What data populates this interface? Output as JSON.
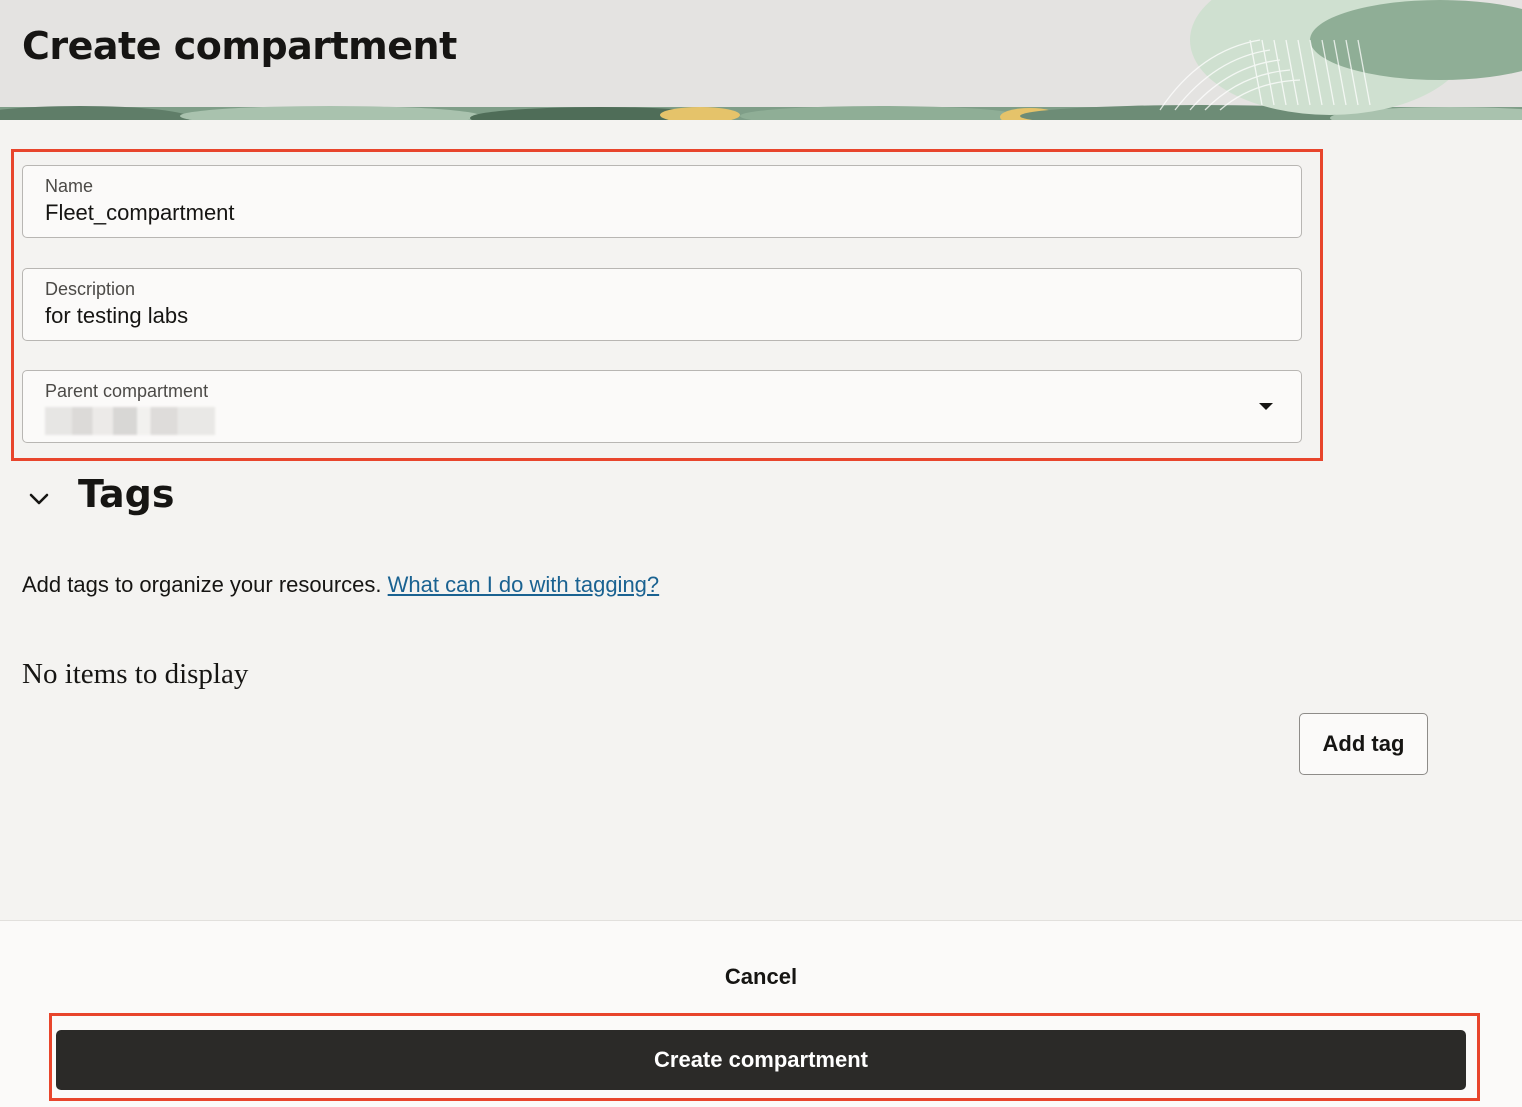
{
  "header": {
    "title": "Create compartment"
  },
  "form": {
    "name": {
      "label": "Name",
      "value": "Fleet_compartment"
    },
    "description": {
      "label": "Description",
      "value": "for testing labs"
    },
    "parent_compartment": {
      "label": "Parent compartment",
      "value_redacted": true
    }
  },
  "tags": {
    "heading": "Tags",
    "description": "Add tags to organize your resources.",
    "help_link": "What can I do with tagging?",
    "empty_message": "No items to display",
    "add_button": "Add tag"
  },
  "footer": {
    "cancel_label": "Cancel",
    "submit_label": "Create compartment"
  },
  "colors": {
    "highlight": "#e8452c",
    "link": "#1a6291",
    "primary_button": "#2b2a28",
    "header_bg": "#e4e3e1",
    "page_bg": "#f4f3f1"
  },
  "icons": {
    "dropdown": "caret-down-icon",
    "tags_toggle": "chevron-down-icon"
  }
}
